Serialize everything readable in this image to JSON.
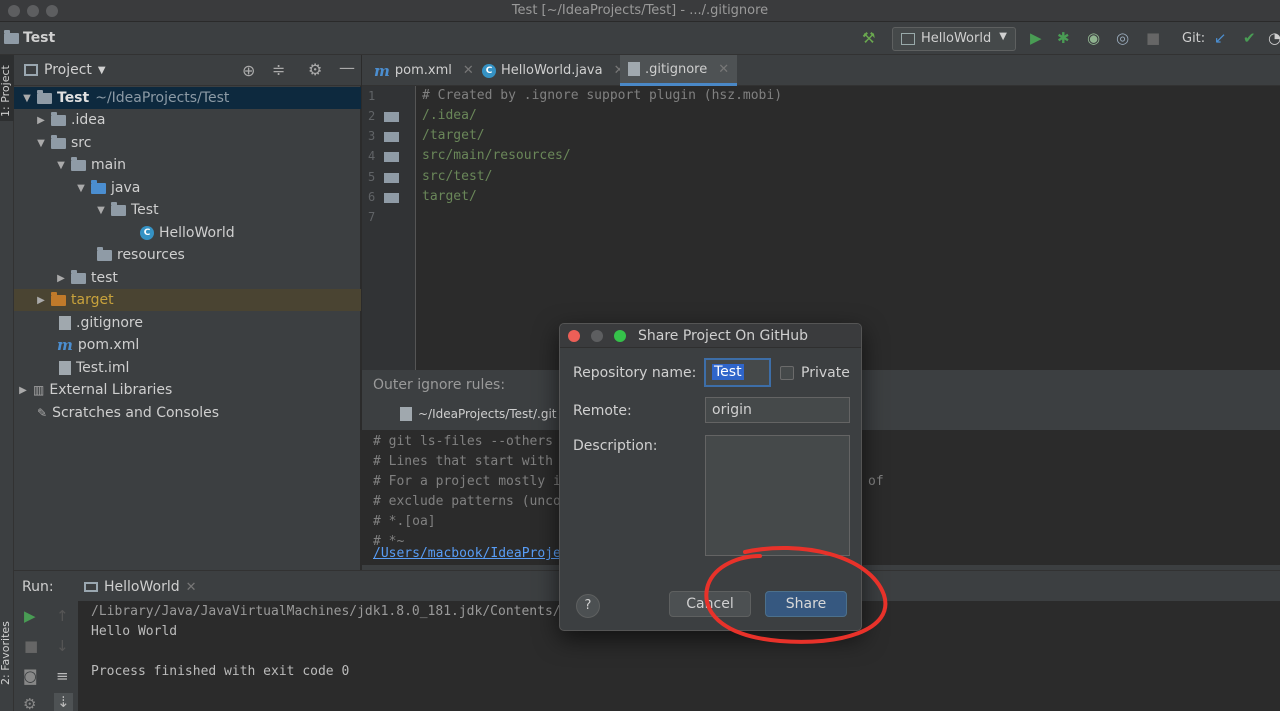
{
  "window": {
    "title": "Test [~/IdeaProjects/Test] - .../.gitignore"
  },
  "navbar": {
    "project": "Test",
    "run_config": "HelloWorld",
    "git_label": "Git:"
  },
  "left_stripe": {
    "project_tab": "1: Project",
    "favorites_tab": "2: Favorites"
  },
  "project_panel": {
    "header": "Project",
    "tree": [
      {
        "label": "Test",
        "sub": "~/IdeaProjects/Test"
      },
      {
        "label": ".idea"
      },
      {
        "label": "src"
      },
      {
        "label": "main"
      },
      {
        "label": "java"
      },
      {
        "label": "Test"
      },
      {
        "label": "HelloWorld"
      },
      {
        "label": "resources"
      },
      {
        "label": "test"
      },
      {
        "label": "target"
      },
      {
        "label": ".gitignore"
      },
      {
        "label": "pom.xml"
      },
      {
        "label": "Test.iml"
      },
      {
        "label": "External Libraries"
      },
      {
        "label": "Scratches and Consoles"
      }
    ]
  },
  "editor": {
    "tabs": [
      {
        "label": "pom.xml"
      },
      {
        "label": "HelloWorld.java"
      },
      {
        "label": ".gitignore"
      }
    ],
    "line_numbers": [
      "1",
      "2",
      "3",
      "4",
      "5",
      "6",
      "7"
    ],
    "lines": [
      "# Created by .ignore support plugin (hsz.mobi)",
      "/.idea/",
      "/target/",
      "src/main/resources/",
      "src/test/",
      "target/",
      ""
    ]
  },
  "outer_ignore": {
    "header": "Outer ignore rules:",
    "file_path": "~/IdeaProjects/Test/.git",
    "lines": [
      "# git ls-files --others",
      "# Lines that start with",
      "# For a project mostly i",
      "# exclude patterns (unco",
      "# *.[oa]",
      "# *~"
    ],
    "trailing": "of",
    "link": "/Users/macbook/IdeaProje"
  },
  "run_panel": {
    "label": "Run:",
    "tab": "HelloWorld",
    "console": [
      "/Library/Java/JavaVirtualMachines/jdk1.8.0_181.jdk/Contents/",
      "Hello World",
      "",
      "Process finished with exit code 0"
    ]
  },
  "dialog": {
    "title": "Share Project On GitHub",
    "repo_label": "Repository name:",
    "repo_value": "Test",
    "private_label": "Private",
    "private_checked": false,
    "remote_label": "Remote:",
    "remote_value": "origin",
    "description_label": "Description:",
    "description_value": "",
    "help": "?",
    "cancel": "Cancel",
    "share": "Share"
  },
  "colors": {
    "accent": "#365880",
    "annotation": "#e8322a",
    "selection": "#0d293e"
  }
}
